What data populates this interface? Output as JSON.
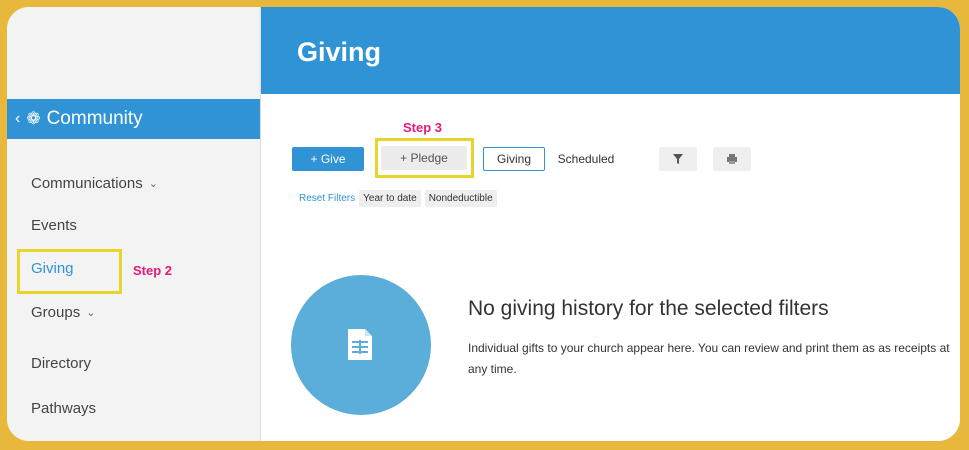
{
  "sidebar": {
    "community_label": "Community",
    "items": [
      {
        "label": "Communications",
        "caret": "⌄"
      },
      {
        "label": "Events"
      },
      {
        "label": "Giving"
      },
      {
        "label": "Groups",
        "caret": "⌄"
      },
      {
        "label": "Directory"
      },
      {
        "label": "Pathways"
      }
    ]
  },
  "header": {
    "title": "Giving"
  },
  "toolbar": {
    "give_label": "+ Give",
    "pledge_label": "+ Pledge",
    "tabs": [
      {
        "label": "Giving"
      },
      {
        "label": "Scheduled"
      }
    ],
    "filter_icon": "filter-icon",
    "print_icon": "print-icon"
  },
  "filters": {
    "reset_label": "Reset Filters",
    "chips": [
      "Year to date",
      "Nondeductible"
    ]
  },
  "annotations": {
    "step2": "Step 2",
    "step3": "Step 3"
  },
  "empty_state": {
    "icon": "document-icon",
    "title": "No giving history for the selected filters",
    "description": "Individual gifts to your church appear here. You can review and print them as as receipts at any time."
  },
  "colors": {
    "accent": "#2f93d6",
    "highlight": "#e7d52a",
    "step_label": "#e5197a",
    "frame": "#e8b83c"
  }
}
